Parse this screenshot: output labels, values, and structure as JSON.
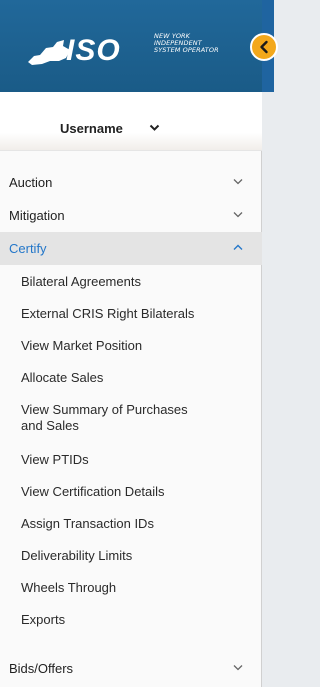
{
  "header": {
    "logo_text": "ISO",
    "logo_sub": [
      "NEW YORK",
      "INDEPENDENT",
      "SYSTEM OPERATOR"
    ],
    "background": "#1b5f8c"
  },
  "collapse_button": {
    "icon": "chevron-left-icon",
    "color": "#f3a81b"
  },
  "user": {
    "name": "Username",
    "icon": "chevron-down-icon"
  },
  "nav": {
    "items": [
      {
        "label": "Auction",
        "icon": "chevron-down-icon"
      },
      {
        "label": "Mitigation",
        "icon": "chevron-down-icon"
      },
      {
        "label": "Certify",
        "icon": "chevron-up-icon",
        "active": true,
        "active_color": "#2477c9"
      }
    ],
    "certify_sub": [
      "Bilateral Agreements",
      "External CRIS Right Bilaterals",
      "View Market Position",
      "Allocate Sales",
      "View Summary of Purchases and Sales",
      "View PTIDs",
      "View Certification Details",
      "Assign Transaction IDs",
      "Deliverability Limits",
      "Wheels Through",
      "Exports"
    ],
    "bottom_item": {
      "label": "Bids/Offers",
      "icon": "chevron-down-icon"
    }
  }
}
